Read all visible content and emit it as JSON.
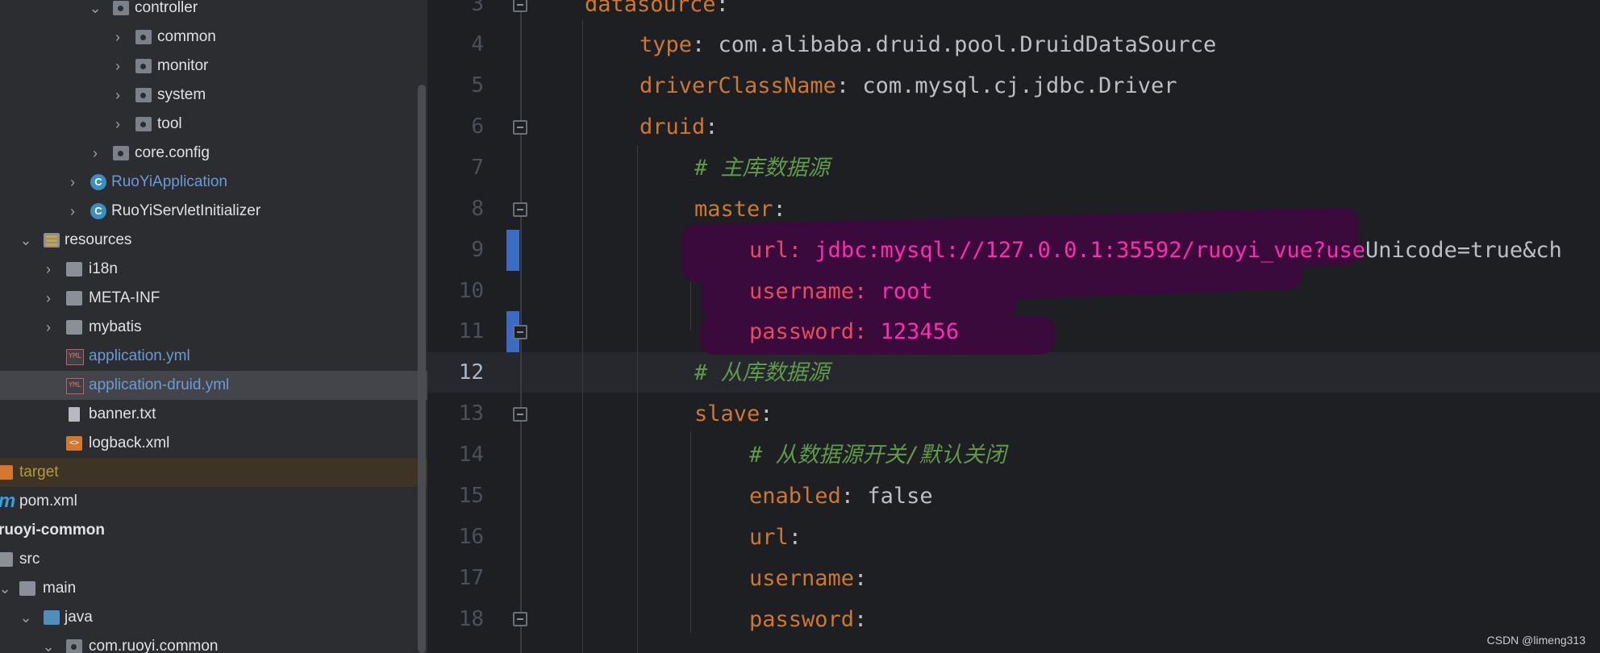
{
  "project_tree": {
    "items": [
      {
        "label": "controller",
        "icon": "package-icon",
        "expanded": true
      },
      {
        "label": "common",
        "icon": "package-icon",
        "expanded": false
      },
      {
        "label": "monitor",
        "icon": "package-icon",
        "expanded": false
      },
      {
        "label": "system",
        "icon": "package-icon",
        "expanded": false
      },
      {
        "label": "tool",
        "icon": "package-icon",
        "expanded": false
      },
      {
        "label": "core.config",
        "icon": "package-icon",
        "expanded": false
      },
      {
        "label": "RuoYiApplication",
        "icon": "spring-class-icon",
        "expanded": false
      },
      {
        "label": "RuoYiServletInitializer",
        "icon": "class-icon",
        "expanded": false
      },
      {
        "label": "resources",
        "icon": "resources-folder-icon",
        "expanded": true
      },
      {
        "label": "i18n",
        "icon": "folder-icon",
        "expanded": false
      },
      {
        "label": "META-INF",
        "icon": "folder-icon",
        "expanded": false
      },
      {
        "label": "mybatis",
        "icon": "folder-icon",
        "expanded": false
      },
      {
        "label": "application.yml",
        "icon": "yml-file-icon"
      },
      {
        "label": "application-druid.yml",
        "icon": "yml-file-icon",
        "selected": true
      },
      {
        "label": "banner.txt",
        "icon": "text-file-icon"
      },
      {
        "label": "logback.xml",
        "icon": "xml-file-icon"
      },
      {
        "label": "target",
        "icon": "excluded-folder-icon"
      },
      {
        "label": "pom.xml",
        "icon": "maven-icon"
      },
      {
        "label": "ruoyi-common",
        "icon": "module-icon"
      },
      {
        "label": "src",
        "icon": "folder-icon"
      },
      {
        "label": "main",
        "icon": "folder-icon",
        "expanded": true
      },
      {
        "label": "java",
        "icon": "source-folder-icon",
        "expanded": true
      },
      {
        "label": "com.ruoyi.common",
        "icon": "package-icon",
        "expanded": true
      }
    ]
  },
  "editor": {
    "current_line": "12",
    "lines": [
      {
        "num": "3",
        "key": "datasource",
        "sep": ":",
        "value": ""
      },
      {
        "num": "4",
        "key": "type",
        "sep": ":",
        "value": " com.alibaba.druid.pool.DruidDataSource"
      },
      {
        "num": "5",
        "key": "driverClassName",
        "sep": ":",
        "value": " com.mysql.cj.jdbc.Driver"
      },
      {
        "num": "6",
        "key": "druid",
        "sep": ":",
        "value": ""
      },
      {
        "num": "7",
        "comment": "# 主库数据源"
      },
      {
        "num": "8",
        "key": "master",
        "sep": ":",
        "value": ""
      },
      {
        "num": "9",
        "key": "url",
        "sep": ":",
        "value": " jdbc:mysql://127.0.0.1:35592/ruoyi_vue?use",
        "value_tail": "Unicode=true&ch"
      },
      {
        "num": "10",
        "key": "username",
        "sep": ":",
        "value": " root"
      },
      {
        "num": "11",
        "key": "password",
        "sep": ":",
        "value": " 123456"
      },
      {
        "num": "12",
        "comment": "# 从库数据源"
      },
      {
        "num": "13",
        "key": "slave",
        "sep": ":",
        "value": ""
      },
      {
        "num": "14",
        "comment": "# 从数据源开关/默认关闭"
      },
      {
        "num": "15",
        "key": "enabled",
        "sep": ":",
        "value": " false"
      },
      {
        "num": "16",
        "key": "url",
        "sep": ":",
        "value": ""
      },
      {
        "num": "17",
        "key": "username",
        "sep": ":",
        "value": ""
      },
      {
        "num": "18",
        "key": "password",
        "sep": ":",
        "value": ""
      }
    ]
  },
  "watermark": "CSDN @limeng313",
  "colors": {
    "key": "#cc7832",
    "value": "#bcbec4",
    "comment": "#5f9a4b",
    "redacted_key": "#e84a5f",
    "redacted_value": "#ff2bb0",
    "selection": "#43454a"
  }
}
